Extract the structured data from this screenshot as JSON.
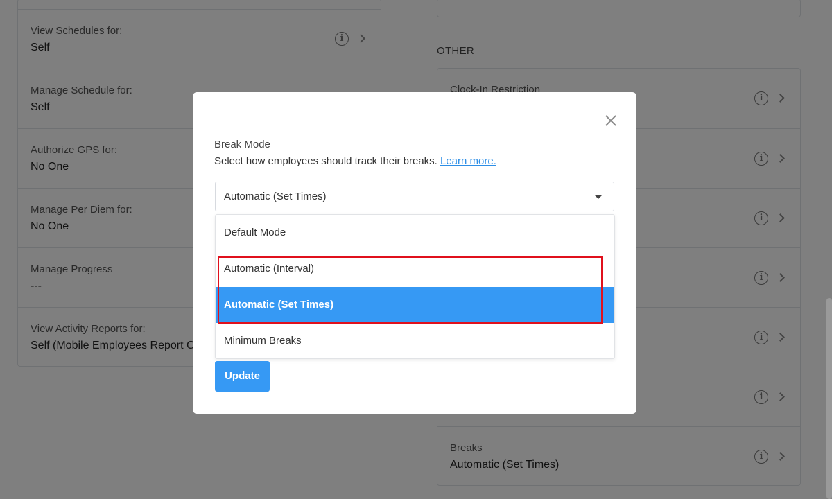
{
  "left_panel": {
    "rows": [
      {
        "label": "View Schedules for:",
        "value": "Self"
      },
      {
        "label": "Manage Schedule for:",
        "value": "Self"
      },
      {
        "label": "Authorize GPS for:",
        "value": "No One"
      },
      {
        "label": "Manage Per Diem for:",
        "value": "No One"
      },
      {
        "label": "Manage Progress",
        "value": "---"
      },
      {
        "label": "View Activity Reports for:",
        "value": "Self (Mobile Employees Report C"
      }
    ]
  },
  "right_panel": {
    "section_title": "OTHER",
    "rows": [
      {
        "label": "Clock-In Restriction",
        "value": ""
      },
      {
        "label": "",
        "value": ""
      },
      {
        "label": "",
        "value": ""
      },
      {
        "label": "",
        "value": ""
      },
      {
        "label": "",
        "value": ""
      },
      {
        "label": "",
        "value": ""
      },
      {
        "label": "Breaks",
        "value": "Automatic (Set Times)"
      }
    ]
  },
  "modal": {
    "title": "Break Mode",
    "description": "Select how employees should track their breaks.",
    "learn_more": "Learn more.",
    "select": {
      "value": "Automatic (Set Times)",
      "options": [
        {
          "label": "Default Mode",
          "selected": false
        },
        {
          "label": "Automatic (Interval)",
          "selected": false
        },
        {
          "label": "Automatic (Set Times)",
          "selected": true
        },
        {
          "label": "Minimum Breaks",
          "selected": false
        }
      ]
    },
    "update_label": "Update"
  },
  "colors": {
    "accent": "#3699f4",
    "link": "#2d8ee6",
    "highlight": "#e0101c"
  },
  "icons": {
    "info": "info-icon",
    "chevron": "chevron-right-icon",
    "close": "close-icon",
    "caret": "caret-down-icon"
  }
}
